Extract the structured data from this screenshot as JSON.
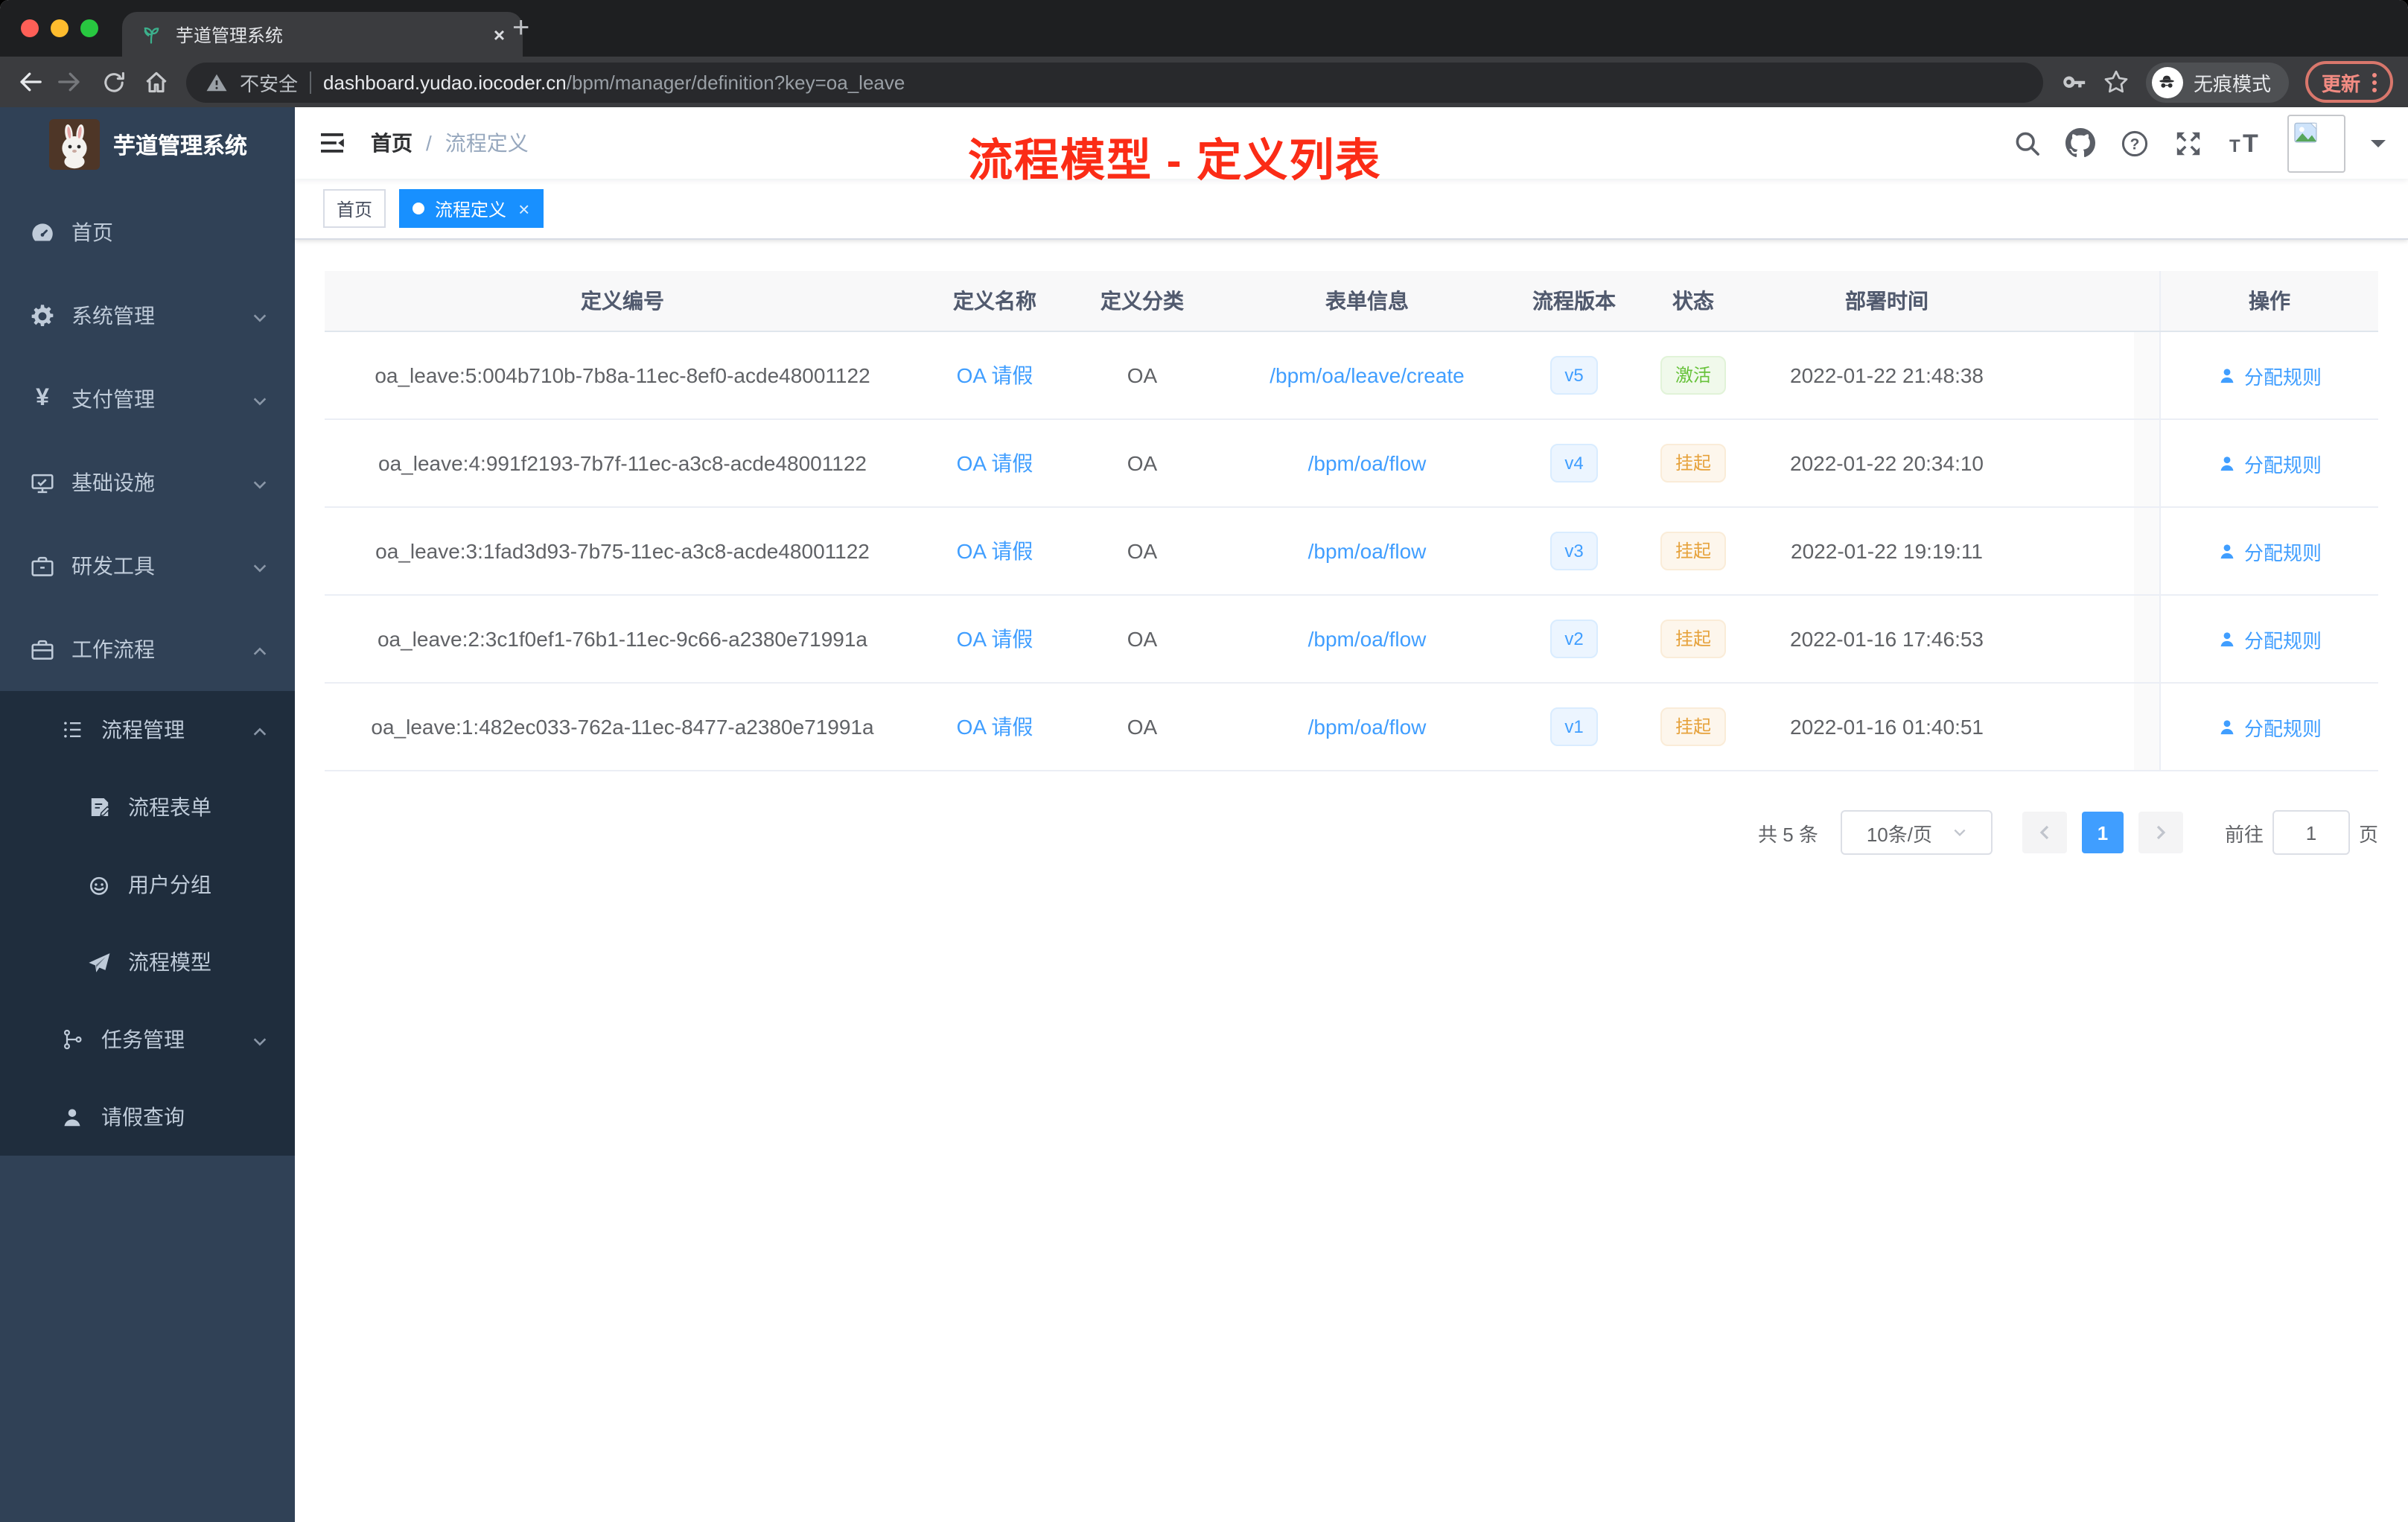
{
  "colors": {
    "primary_link": "#409eff",
    "tag_active_bg": "#1890ff",
    "status_active_green": "#67c23a",
    "status_suspended_orange": "#e6a23c",
    "sidebar_bg": "#304156",
    "submenu_bg": "#1f2d3d",
    "annotation_red": "#fb2c16",
    "traffic_lights": [
      "#ff5f57",
      "#febc2e",
      "#28c840"
    ]
  },
  "browser": {
    "tab_title": "芋道管理系统",
    "tab_close": "×",
    "new_tab": "+",
    "address": {
      "security_label": "不安全",
      "host": "dashboard.yudao.iocoder.cn",
      "path": "/bpm/manager/definition?key=oa_leave"
    },
    "incognito_label": "无痕模式",
    "update_label": "更新"
  },
  "sidebar": {
    "title": "芋道管理系统",
    "menu": [
      {
        "label": "首页",
        "icon": "dashboard-icon"
      },
      {
        "label": "系统管理",
        "icon": "gear-icon",
        "state": "collapsed"
      },
      {
        "label": "支付管理",
        "icon": "yen-icon",
        "state": "collapsed"
      },
      {
        "label": "基础设施",
        "icon": "monitor-icon",
        "state": "collapsed"
      },
      {
        "label": "研发工具",
        "icon": "toolbox-icon",
        "state": "collapsed"
      },
      {
        "label": "工作流程",
        "icon": "briefcase-icon",
        "state": "expanded",
        "children": [
          {
            "label": "流程管理",
            "icon": "list-tree-icon",
            "state": "expanded",
            "children": [
              {
                "label": "流程表单",
                "icon": "form-icon"
              },
              {
                "label": "用户分组",
                "icon": "robot-icon"
              },
              {
                "label": "流程模型",
                "icon": "paper-plane-icon"
              }
            ]
          },
          {
            "label": "任务管理",
            "icon": "tree-icon",
            "state": "collapsed"
          },
          {
            "label": "请假查询",
            "icon": "user-icon"
          }
        ]
      }
    ]
  },
  "header": {
    "breadcrumb": {
      "home": "首页",
      "separator": "/",
      "current": "流程定义"
    }
  },
  "annotation": "流程模型 - 定义列表",
  "tags": [
    {
      "label": "首页",
      "active": false
    },
    {
      "label": "流程定义",
      "active": true,
      "close": "×"
    }
  ],
  "table": {
    "columns": [
      "定义编号",
      "定义名称",
      "定义分类",
      "表单信息",
      "流程版本",
      "状态",
      "部署时间",
      "操作"
    ],
    "rows": [
      {
        "id": "oa_leave:5:004b710b-7b8a-11ec-8ef0-acde48001122",
        "name": "OA 请假",
        "category": "OA",
        "form": "/bpm/oa/leave/create",
        "version": "v5",
        "status": "激活",
        "status_type": "success",
        "time": "2022-01-22 21:48:38",
        "action": "分配规则"
      },
      {
        "id": "oa_leave:4:991f2193-7b7f-11ec-a3c8-acde48001122",
        "name": "OA 请假",
        "category": "OA",
        "form": "/bpm/oa/flow",
        "version": "v4",
        "status": "挂起",
        "status_type": "warning",
        "time": "2022-01-22 20:34:10",
        "action": "分配规则"
      },
      {
        "id": "oa_leave:3:1fad3d93-7b75-11ec-a3c8-acde48001122",
        "name": "OA 请假",
        "category": "OA",
        "form": "/bpm/oa/flow",
        "version": "v3",
        "status": "挂起",
        "status_type": "warning",
        "time": "2022-01-22 19:19:11",
        "action": "分配规则"
      },
      {
        "id": "oa_leave:2:3c1f0ef1-76b1-11ec-9c66-a2380e71991a",
        "name": "OA 请假",
        "category": "OA",
        "form": "/bpm/oa/flow",
        "version": "v2",
        "status": "挂起",
        "status_type": "warning",
        "time": "2022-01-16 17:46:53",
        "action": "分配规则"
      },
      {
        "id": "oa_leave:1:482ec033-762a-11ec-8477-a2380e71991a",
        "name": "OA 请假",
        "category": "OA",
        "form": "/bpm/oa/flow",
        "version": "v1",
        "status": "挂起",
        "status_type": "warning",
        "time": "2022-01-16 01:40:51",
        "action": "分配规则"
      }
    ]
  },
  "pagination": {
    "total": "共 5 条",
    "page_size": "10条/页",
    "current_page": "1",
    "goto_label": "前往",
    "goto_value": "1",
    "page_unit": "页"
  }
}
